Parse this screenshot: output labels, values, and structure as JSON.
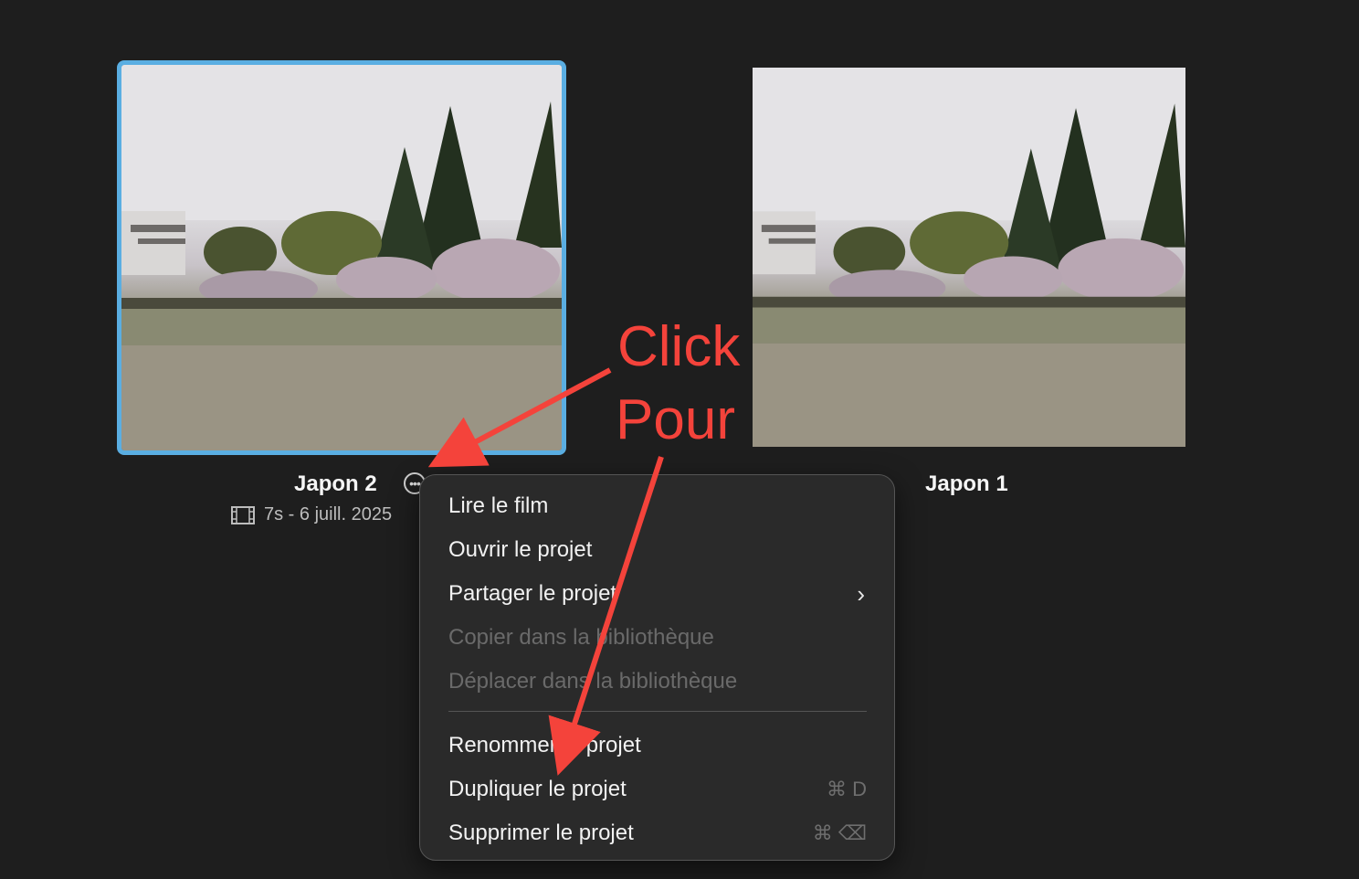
{
  "projects": [
    {
      "title": "Japon 2",
      "meta": "7s - 6 juill. 2025",
      "selected": true
    },
    {
      "title": "Japon 1"
    }
  ],
  "menu": {
    "items": [
      {
        "label": "Lire le film",
        "enabled": true
      },
      {
        "label": "Ouvrir le projet",
        "enabled": true
      },
      {
        "label": "Partager le projet",
        "enabled": true,
        "submenu": true
      },
      {
        "label": "Copier dans la bibliothèque",
        "enabled": false
      },
      {
        "label": "Déplacer dans la bibliothèque",
        "enabled": false
      },
      {
        "label": "Renommer le projet",
        "enabled": true
      },
      {
        "label": "Dupliquer le projet",
        "enabled": true,
        "shortcut": "⌘ D"
      },
      {
        "label": "Supprimer le projet",
        "enabled": true,
        "shortcut": "⌘ ⌫"
      }
    ]
  },
  "annotation": {
    "line1": "Click",
    "line2": "Pour",
    "color": "#f4433b"
  },
  "colors": {
    "background": "#1e1e1e",
    "selection": "#5aaee2",
    "menu_bg": "#2a2a2a"
  },
  "icons": {
    "more": "ellipsis-circle-icon",
    "film": "film-strip-icon",
    "submenu": "chevron-right-icon"
  }
}
